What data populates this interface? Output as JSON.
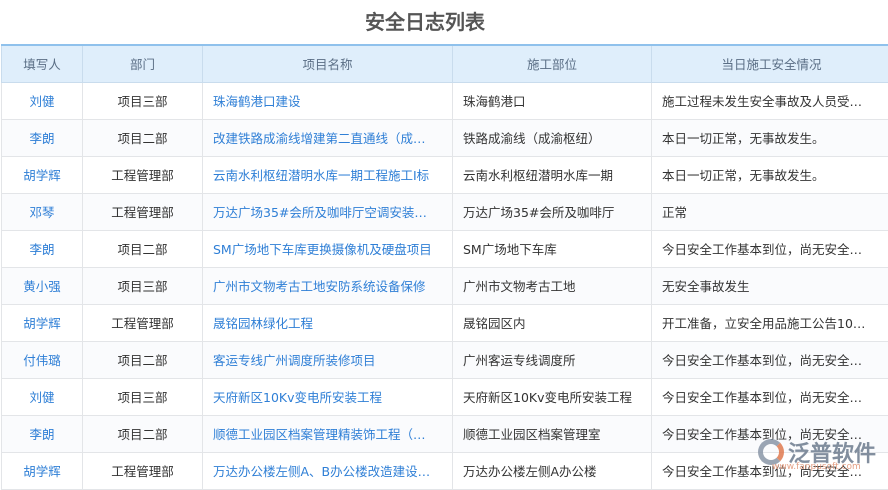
{
  "title": "安全日志列表",
  "columns": [
    "填写人",
    "部门",
    "项目名称",
    "施工部位",
    "当日施工安全情况"
  ],
  "rows": [
    {
      "writer": "刘健",
      "dept": "项目三部",
      "project": "珠海鹤港口建设",
      "site": "珠海鹤港口",
      "status": "施工过程未发生安全事故及人员受…"
    },
    {
      "writer": "李朗",
      "dept": "项目二部",
      "project": "改建铁路成渝线增建第二直通线（成…",
      "site": "铁路成渝线（成渝枢纽）",
      "status": "本日一切正常，无事故发生。"
    },
    {
      "writer": "胡学辉",
      "dept": "工程管理部",
      "project": "云南水利枢纽潜明水库一期工程施工I标",
      "site": "云南水利枢纽潜明水库一期",
      "status": "本日一切正常，无事故发生。"
    },
    {
      "writer": "邓琴",
      "dept": "工程管理部",
      "project": "万达广场35#会所及咖啡厅空调安装…",
      "site": "万达广场35#会所及咖啡厅",
      "status": "正常"
    },
    {
      "writer": "李朗",
      "dept": "项目二部",
      "project": "SM广场地下车库更换摄像机及硬盘项目",
      "site": "SM广场地下车库",
      "status": "今日安全工作基本到位，尚无安全…"
    },
    {
      "writer": "黄小强",
      "dept": "项目三部",
      "project": "广州市文物考古工地安防系统设备保修",
      "site": "广州市文物考古工地",
      "status": "无安全事故发生"
    },
    {
      "writer": "胡学辉",
      "dept": "工程管理部",
      "project": "晟铭园林绿化工程",
      "site": "晟铭园区内",
      "status": "开工准备，立安全用品施工公告10…"
    },
    {
      "writer": "付伟璐",
      "dept": "项目二部",
      "project": "客运专线广州调度所装修项目",
      "site": "广州客运专线调度所",
      "status": "今日安全工作基本到位，尚无安全…"
    },
    {
      "writer": "刘健",
      "dept": "项目三部",
      "project": "天府新区10Kv变电所安装工程",
      "site": "天府新区10Kv变电所安装工程",
      "status": "今日安全工作基本到位，尚无安全…"
    },
    {
      "writer": "李朗",
      "dept": "项目二部",
      "project": "顺德工业园区档案管理精装饰工程（…",
      "site": "顺德工业园区档案管理室",
      "status": "今日安全工作基本到位，尚无安全…"
    },
    {
      "writer": "胡学辉",
      "dept": "工程管理部",
      "project": "万达办公楼左侧A、B办公楼改造建设…",
      "site": "万达办公楼左侧A办公楼",
      "status": "今日安全工作基本到位，尚无安全…"
    }
  ],
  "watermark": {
    "name": "泛普软件",
    "url": "www.fanpusoft.com"
  }
}
